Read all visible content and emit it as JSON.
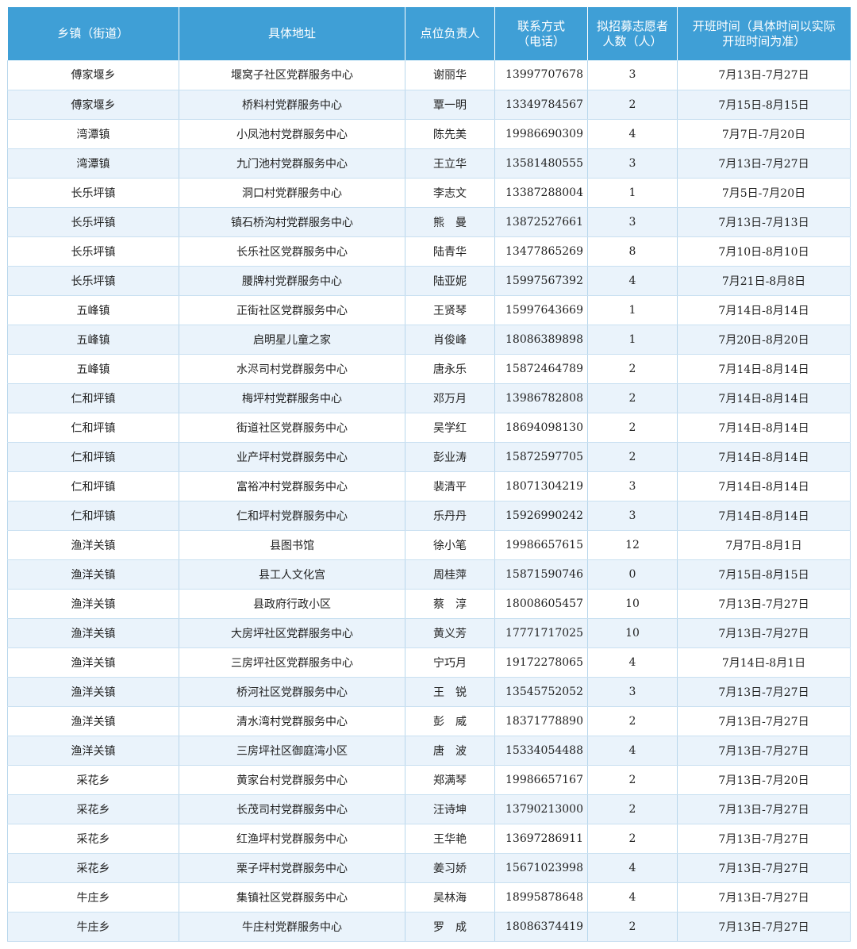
{
  "header": {
    "col_town": "乡镇（街道）",
    "col_address": "具体地址",
    "col_contact": "点位负责人",
    "col_phone_1": "联系方式",
    "col_phone_2": "（电话）",
    "col_count_1": "拟招募志愿者",
    "col_count_2": "人数（人）",
    "col_time_1": "开班时间（具体时间以实际",
    "col_time_2": "开班时间为准）"
  },
  "colors": {
    "header_bg": "#3f9fd6",
    "header_text": "#ffffff",
    "row_alt_bg": "#eaf3fb"
  },
  "rows": [
    {
      "town": "傅家堰乡",
      "address": "堰窝子社区党群服务中心",
      "contact": "谢丽华",
      "phone": "13997707678",
      "count": "3",
      "time": "7月13日-7月27日"
    },
    {
      "town": "傅家堰乡",
      "address": "桥料村党群服务中心",
      "contact": "覃一明",
      "phone": "13349784567",
      "count": "2",
      "time": "7月15日-8月15日"
    },
    {
      "town": "湾潭镇",
      "address": "小凤池村党群服务中心",
      "contact": "陈先美",
      "phone": "19986690309",
      "count": "4",
      "time": "7月7日-7月20日"
    },
    {
      "town": "湾潭镇",
      "address": "九门池村党群服务中心",
      "contact": "王立华",
      "phone": "13581480555",
      "count": "3",
      "time": "7月13日-7月27日"
    },
    {
      "town": "长乐坪镇",
      "address": "洞口村党群服务中心",
      "contact": "李志文",
      "phone": "13387288004",
      "count": "1",
      "time": "7月5日-7月20日"
    },
    {
      "town": "长乐坪镇",
      "address": "镇石桥沟村党群服务中心",
      "contact": "熊　曼",
      "phone": "13872527661",
      "count": "3",
      "time": "7月13日-7月13日"
    },
    {
      "town": "长乐坪镇",
      "address": "长乐社区党群服务中心",
      "contact": "陆青华",
      "phone": "13477865269",
      "count": "8",
      "time": "7月10日-8月10日"
    },
    {
      "town": "长乐坪镇",
      "address": "腰牌村党群服务中心",
      "contact": "陆亚妮",
      "phone": "15997567392",
      "count": "4",
      "time": "7月21日-8月8日"
    },
    {
      "town": "五峰镇",
      "address": "正街社区党群服务中心",
      "contact": "王贤琴",
      "phone": "15997643669",
      "count": "1",
      "time": "7月14日-8月14日"
    },
    {
      "town": "五峰镇",
      "address": "启明星儿童之家",
      "contact": "肖俊峰",
      "phone": "18086389898",
      "count": "1",
      "time": "7月20日-8月20日"
    },
    {
      "town": "五峰镇",
      "address": "水浕司村党群服务中心",
      "contact": "唐永乐",
      "phone": "15872464789",
      "count": "2",
      "time": "7月14日-8月14日"
    },
    {
      "town": "仁和坪镇",
      "address": "梅坪村党群服务中心",
      "contact": "邓万月",
      "phone": "13986782808",
      "count": "2",
      "time": "7月14日-8月14日"
    },
    {
      "town": "仁和坪镇",
      "address": "街道社区党群服务中心",
      "contact": "吴学红",
      "phone": "18694098130",
      "count": "2",
      "time": "7月14日-8月14日"
    },
    {
      "town": "仁和坪镇",
      "address": "业产坪村党群服务中心",
      "contact": "彭业涛",
      "phone": "15872597705",
      "count": "2",
      "time": "7月14日-8月14日"
    },
    {
      "town": "仁和坪镇",
      "address": "富裕冲村党群服务中心",
      "contact": "裴清平",
      "phone": "18071304219",
      "count": "3",
      "time": "7月14日-8月14日"
    },
    {
      "town": "仁和坪镇",
      "address": "仁和坪村党群服务中心",
      "contact": "乐丹丹",
      "phone": "15926990242",
      "count": "3",
      "time": "7月14日-8月14日"
    },
    {
      "town": "渔洋关镇",
      "address": "县图书馆",
      "contact": "徐小笔",
      "phone": "19986657615",
      "count": "12",
      "time": "7月7日-8月1日"
    },
    {
      "town": "渔洋关镇",
      "address": "县工人文化宫",
      "contact": "周桂萍",
      "phone": "15871590746",
      "count": "0",
      "time": "7月15日-8月15日"
    },
    {
      "town": "渔洋关镇",
      "address": "县政府行政小区",
      "contact": "蔡　淳",
      "phone": "18008605457",
      "count": "10",
      "time": "7月13日-7月27日"
    },
    {
      "town": "渔洋关镇",
      "address": "大房坪社区党群服务中心",
      "contact": "黄义芳",
      "phone": "17771717025",
      "count": "10",
      "time": "7月13日-7月27日"
    },
    {
      "town": "渔洋关镇",
      "address": "三房坪社区党群服务中心",
      "contact": "宁巧月",
      "phone": "19172278065",
      "count": "4",
      "time": "7月14日-8月1日"
    },
    {
      "town": "渔洋关镇",
      "address": "桥河社区党群服务中心",
      "contact": "王　锐",
      "phone": "13545752052",
      "count": "3",
      "time": "7月13日-7月27日"
    },
    {
      "town": "渔洋关镇",
      "address": "清水湾村党群服务中心",
      "contact": "彭　威",
      "phone": "18371778890",
      "count": "2",
      "time": "7月13日-7月27日"
    },
    {
      "town": "渔洋关镇",
      "address": "三房坪社区御庭湾小区",
      "contact": "唐　波",
      "phone": "15334054488",
      "count": "4",
      "time": "7月13日-7月27日"
    },
    {
      "town": "采花乡",
      "address": "黄家台村党群服务中心",
      "contact": "郑满琴",
      "phone": "19986657167",
      "count": "2",
      "time": "7月13日-7月20日"
    },
    {
      "town": "采花乡",
      "address": "长茂司村党群服务中心",
      "contact": "汪诗坤",
      "phone": "13790213000",
      "count": "2",
      "time": "7月13日-7月27日"
    },
    {
      "town": "采花乡",
      "address": "红渔坪村党群服务中心",
      "contact": "王华艳",
      "phone": "13697286911",
      "count": "2",
      "time": "7月13日-7月27日"
    },
    {
      "town": "采花乡",
      "address": "栗子坪村党群服务中心",
      "contact": "姜习娇",
      "phone": "15671023998",
      "count": "4",
      "time": "7月13日-7月27日"
    },
    {
      "town": "牛庄乡",
      "address": "集镇社区党群服务中心",
      "contact": "吴林海",
      "phone": "18995878648",
      "count": "4",
      "time": "7月13日-7月27日"
    },
    {
      "town": "牛庄乡",
      "address": "牛庄村党群服务中心",
      "contact": "罗　成",
      "phone": "18086374419",
      "count": "2",
      "time": "7月13日-7月27日"
    }
  ]
}
